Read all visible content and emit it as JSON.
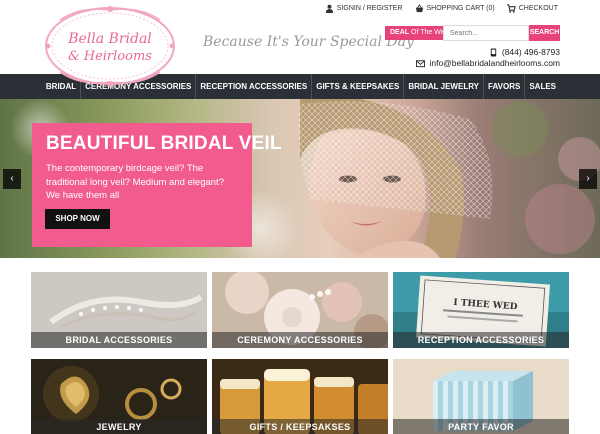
{
  "logo": {
    "line1": "Bella Bridal",
    "line2": "& Heirlooms"
  },
  "tagline": "Because It's Your Special Day",
  "toplinks": [
    {
      "label": "SIGNIN / REGISTER",
      "icon": "user-icon"
    },
    {
      "label": "SHOPPING CART (0)",
      "icon": "basket-icon"
    },
    {
      "label": "CHECKOUT",
      "icon": "cart-icon"
    }
  ],
  "deal": {
    "bold": "DEAL",
    "rest": " Of The Week"
  },
  "search": {
    "placeholder": "Search...",
    "button": "SEARCH"
  },
  "contact": {
    "phone": "(844) 496-8793",
    "email": "info@bellabridalandheirlooms.com"
  },
  "nav": [
    "BRIDAL",
    "CEREMONY ACCESSORIES",
    "RECEPTION ACCESSORIES",
    "GIFTS & KEEPSAKES",
    "BRIDAL JEWELRY",
    "FAVORS",
    "SALES"
  ],
  "hero": {
    "title": "BEAUTIFUL BRIDAL VEIL",
    "text": "The contemporary birdcage veil? The traditional long veil? Medium and elegant? We have them all",
    "button": "SHOP NOW",
    "prev": "‹",
    "next": "›"
  },
  "tiles": [
    {
      "label": "BRIDAL ACCESSORIES"
    },
    {
      "label": "CEREMONY ACCESSORIES"
    },
    {
      "label": "RECEPTION ACCESSORIES"
    },
    {
      "label": "JEWELRY"
    },
    {
      "label": "GIFTS / KEEPSAKSES"
    },
    {
      "label": "PARTY FAVOR"
    }
  ],
  "reception_card": {
    "line1": "I THEE WED"
  },
  "colors": {
    "accent": "#e8427a",
    "promo": "#f25b8e",
    "nav": "#2b3036"
  }
}
